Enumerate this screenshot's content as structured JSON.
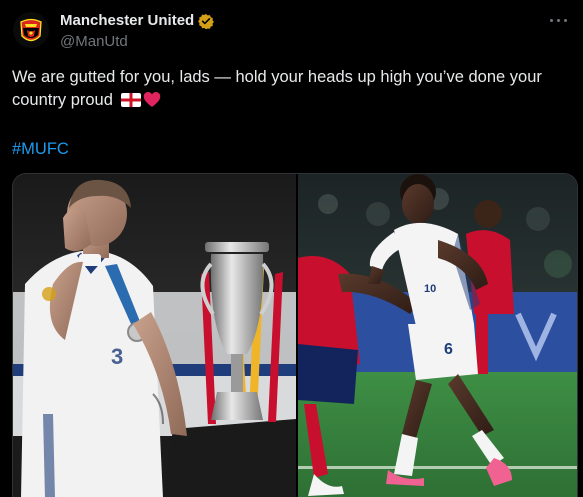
{
  "account": {
    "name": "Manchester United",
    "handle": "@ManUtd",
    "verified_color": "#d4a017",
    "avatar_icon": "manchester-united-crest"
  },
  "post": {
    "text": "We are gutted for you, lads — hold your heads up high you’ve done your country proud",
    "emojis": [
      "england-flag",
      "red-heart"
    ],
    "hashtag": "#MUFC"
  },
  "media": {
    "images": [
      "england-player-with-trophy-photo",
      "england-vs-spain-match-photo"
    ]
  },
  "colors": {
    "background": "#000000",
    "text": "#e7e9ea",
    "secondary": "#71767b",
    "link": "#1d9bf0"
  }
}
